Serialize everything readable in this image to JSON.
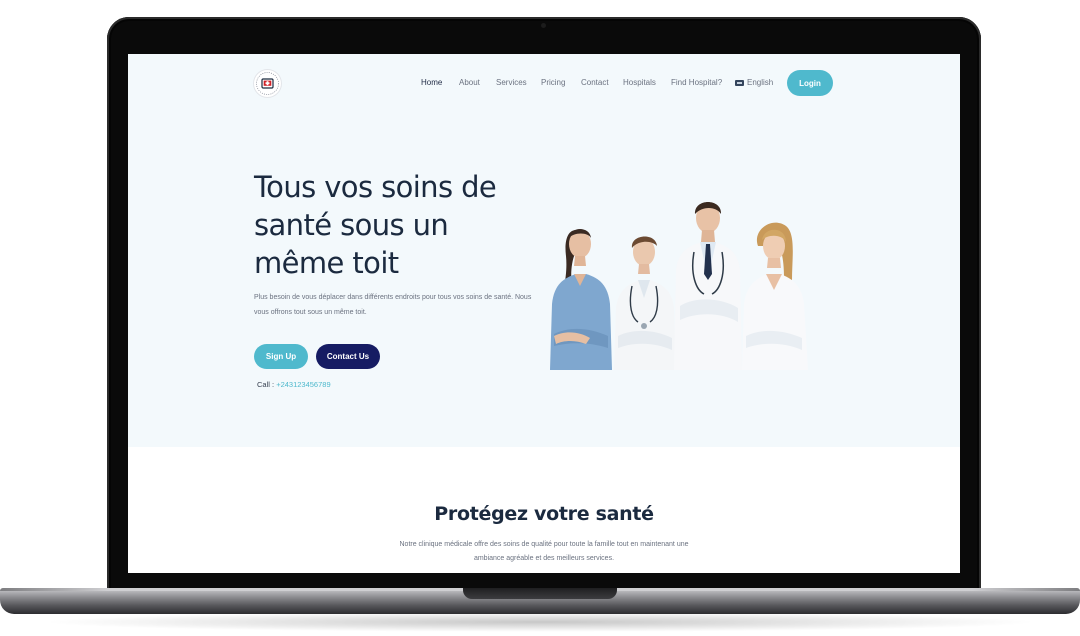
{
  "nav": {
    "items": [
      {
        "label": "Home",
        "active": true
      },
      {
        "label": "About"
      },
      {
        "label": "Services"
      },
      {
        "label": "Pricing"
      },
      {
        "label": "Contact"
      },
      {
        "label": "Hospitals"
      },
      {
        "label": "Find Hospital?"
      }
    ],
    "language": "English",
    "login": "Login"
  },
  "hero": {
    "title": "Tous vos soins de santé sous un même toit",
    "description": "Plus besoin de vous déplacer dans différents endroits pour tous vos soins de santé. Nous vous offrons tout sous un même toit.",
    "signup": "Sign Up",
    "contact": "Contact Us",
    "call_label": "Call :",
    "phone": "+243123456789"
  },
  "section": {
    "title": "Protégez votre santé",
    "description": "Notre clinique médicale offre des soins de qualité pour toute la famille tout en maintenant une ambiance agréable et des meilleurs services."
  },
  "colors": {
    "accent": "#4fb9cd",
    "navy": "#161c63",
    "hero_bg": "#f3f9fc",
    "heading": "#1b2a3f"
  },
  "icons": {
    "logo": "clinic-logo",
    "language": "language-flag-icon"
  }
}
